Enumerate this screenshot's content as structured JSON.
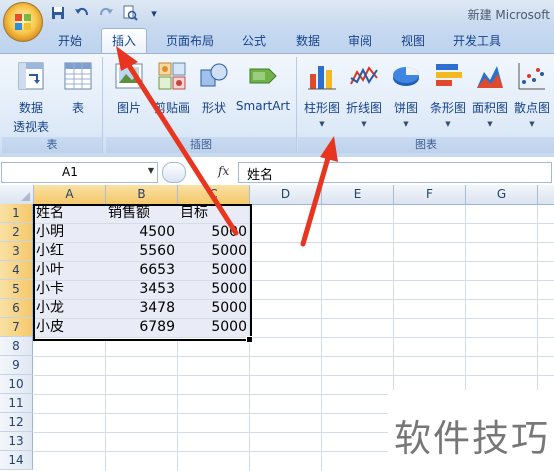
{
  "window": {
    "title": "新建 Microsoft"
  },
  "quick_access": [
    {
      "name": "save",
      "icon": "save-icon"
    },
    {
      "name": "undo",
      "icon": "undo-icon"
    },
    {
      "name": "redo",
      "icon": "redo-icon"
    },
    {
      "name": "print-preview",
      "icon": "print-preview-icon"
    },
    {
      "name": "customize",
      "icon": "customize-qat-icon"
    }
  ],
  "tabs": [
    {
      "label": "开始",
      "active": false
    },
    {
      "label": "插入",
      "active": true
    },
    {
      "label": "页面布局",
      "active": false
    },
    {
      "label": "公式",
      "active": false
    },
    {
      "label": "数据",
      "active": false
    },
    {
      "label": "审阅",
      "active": false
    },
    {
      "label": "视图",
      "active": false
    },
    {
      "label": "开发工具",
      "active": false
    }
  ],
  "ribbon": {
    "groups": {
      "table": {
        "label": "表",
        "pivot": {
          "label1": "数据",
          "label2": "透视表",
          "icon": "pivot-table-icon"
        },
        "table": {
          "label": "表",
          "icon": "table-icon"
        }
      },
      "illustrations": {
        "label": "插图",
        "picture": {
          "label": "图片",
          "icon": "picture-icon"
        },
        "clipart": {
          "label": "剪贴画",
          "icon": "clipart-icon"
        },
        "shapes": {
          "label": "形状",
          "icon": "shapes-icon"
        },
        "smartart": {
          "label": "SmartArt",
          "icon": "smartart-icon"
        }
      },
      "charts": {
        "label": "图表",
        "column": {
          "label": "柱形图",
          "icon": "column-chart-icon"
        },
        "line": {
          "label": "折线图",
          "icon": "line-chart-icon"
        },
        "pie": {
          "label": "饼图",
          "icon": "pie-chart-icon"
        },
        "bar": {
          "label": "条形图",
          "icon": "bar-chart-icon"
        },
        "area": {
          "label": "面积图",
          "icon": "area-chart-icon"
        },
        "scatter": {
          "label": "散点图",
          "icon": "scatter-chart-icon"
        }
      }
    }
  },
  "formula_bar": {
    "name_box": "A1",
    "fx": "fx",
    "content": "姓名"
  },
  "sheet": {
    "columns": [
      "A",
      "B",
      "C",
      "D",
      "E",
      "F",
      "G"
    ],
    "rows": [
      "1",
      "2",
      "3",
      "4",
      "5",
      "6",
      "7",
      "8",
      "9",
      "10",
      "11",
      "12",
      "13",
      "14"
    ],
    "headers": [
      "姓名",
      "销售额",
      "目标"
    ],
    "data": [
      {
        "name": "小明",
        "sales": "4500",
        "target": "5000"
      },
      {
        "name": "小红",
        "sales": "5560",
        "target": "5000"
      },
      {
        "name": "小叶",
        "sales": "6653",
        "target": "5000"
      },
      {
        "name": "小卡",
        "sales": "3453",
        "target": "5000"
      },
      {
        "name": "小龙",
        "sales": "3478",
        "target": "5000"
      },
      {
        "name": "小皮",
        "sales": "6789",
        "target": "5000"
      }
    ]
  },
  "watermark": "软件技巧",
  "colors": {
    "arrow": "#e8351f",
    "accent": "#15428b"
  }
}
